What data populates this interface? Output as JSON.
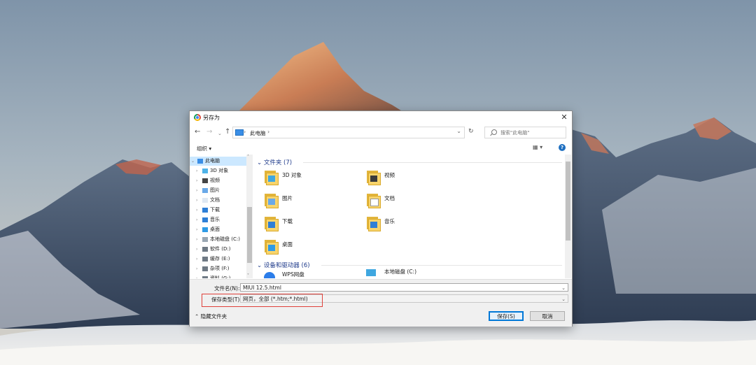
{
  "window": {
    "title": "另存为",
    "close_glyph": "✕"
  },
  "navigation": {
    "back_glyph": "←",
    "forward_glyph": "→",
    "recent_glyph": "⌄",
    "up_glyph": "↑",
    "address": {
      "location": "此电脑",
      "separator": "›",
      "dropdown_glyph": "⌄"
    },
    "refresh_glyph": "↻",
    "search_placeholder": "搜索\"此电脑\""
  },
  "toolbar": {
    "organize": "组织 ▾",
    "view": "▦ ▾",
    "help": "?"
  },
  "nav_tree": [
    {
      "label": "此电脑",
      "arrow": "⌄",
      "icon": "pc-icon",
      "selected": true,
      "indent": 0
    },
    {
      "label": "3D 对象",
      "arrow": "›",
      "icon": "3d-objects-icon",
      "indent": 1
    },
    {
      "label": "视频",
      "arrow": "›",
      "icon": "video-icon",
      "indent": 1
    },
    {
      "label": "图片",
      "arrow": "›",
      "icon": "pictures-icon",
      "indent": 1
    },
    {
      "label": "文档",
      "arrow": "›",
      "icon": "documents-icon",
      "indent": 1
    },
    {
      "label": "下载",
      "arrow": "›",
      "icon": "download-icon",
      "indent": 1
    },
    {
      "label": "音乐",
      "arrow": "›",
      "icon": "music-icon",
      "indent": 1
    },
    {
      "label": "桌面",
      "arrow": "›",
      "icon": "desktop-icon",
      "indent": 1
    },
    {
      "label": "本地磁盘 (C:)",
      "arrow": "›",
      "icon": "drive-c-icon",
      "indent": 1
    },
    {
      "label": "软件 (D:)",
      "arrow": "›",
      "icon": "drive-icon",
      "indent": 1
    },
    {
      "label": "缓存 (E:)",
      "arrow": "›",
      "icon": "drive-icon",
      "indent": 1
    },
    {
      "label": "杂项 (F:)",
      "arrow": "›",
      "icon": "drive-icon",
      "indent": 1
    },
    {
      "label": "资料 (G:)",
      "arrow": "›",
      "icon": "drive-icon",
      "indent": 1
    }
  ],
  "content": {
    "folders_header": "文件夹 (7)",
    "folders": [
      {
        "name": "3D 对象",
        "icon": "3d-objects-icon",
        "badge": "#3fa7e0"
      },
      {
        "name": "视频",
        "icon": "video-icon",
        "badge": "#3b3b3b"
      },
      {
        "name": "图片",
        "icon": "pictures-icon",
        "badge": "#6aa9e8"
      },
      {
        "name": "文档",
        "icon": "documents-icon",
        "badge": "#ffffff"
      },
      {
        "name": "下载",
        "icon": "download-icon",
        "badge": "#2f7fd6"
      },
      {
        "name": "音乐",
        "icon": "music-icon",
        "badge": "#2f7fd6"
      },
      {
        "name": "桌面",
        "icon": "desktop-icon",
        "badge": "#2f9be6"
      }
    ],
    "devices_header": "设备和驱动器 (6)",
    "devices": [
      {
        "name": "WPS网盘",
        "icon": "cloud-drive-icon"
      },
      {
        "name": "本地磁盘 (C:)",
        "icon": "drive-c-icon"
      }
    ]
  },
  "footer": {
    "filename_label": "文件名(N):",
    "filename_value": "MIUI 12.5.html",
    "filetype_label": "保存类型(T):",
    "filetype_value": "网页，全部 (*.htm;*.html)",
    "hide_folders": "⌃  隐藏文件夹",
    "save_button": "保存(S)",
    "cancel_button": "取消"
  },
  "colors": {
    "accent": "#0078d7",
    "highlight_box": "#e0403a",
    "selected_bg": "#cce8ff"
  }
}
